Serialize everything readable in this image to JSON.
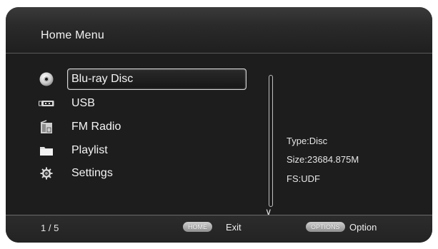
{
  "header": {
    "title": "Home Menu"
  },
  "menu": {
    "items": [
      {
        "label": "Blu-ray Disc",
        "icon": "disc-icon",
        "selected": true
      },
      {
        "label": "USB",
        "icon": "usb-icon",
        "selected": false
      },
      {
        "label": "FM Radio",
        "icon": "radio-icon",
        "selected": false
      },
      {
        "label": "Playlist",
        "icon": "folder-icon",
        "selected": false
      },
      {
        "label": "Settings",
        "icon": "gear-icon",
        "selected": false
      }
    ]
  },
  "info": {
    "type": "Type:Disc",
    "size": "Size:23684.875M",
    "fs": "FS:UDF"
  },
  "footer": {
    "page": "1 / 5",
    "home_button": "HOME",
    "home_action": "Exit",
    "options_button": "OPTIONS",
    "options_action": "Option"
  },
  "colors": {
    "background": "#1d1d1d",
    "text": "#f4f4f4",
    "selection_border": "#d8d8d8"
  }
}
